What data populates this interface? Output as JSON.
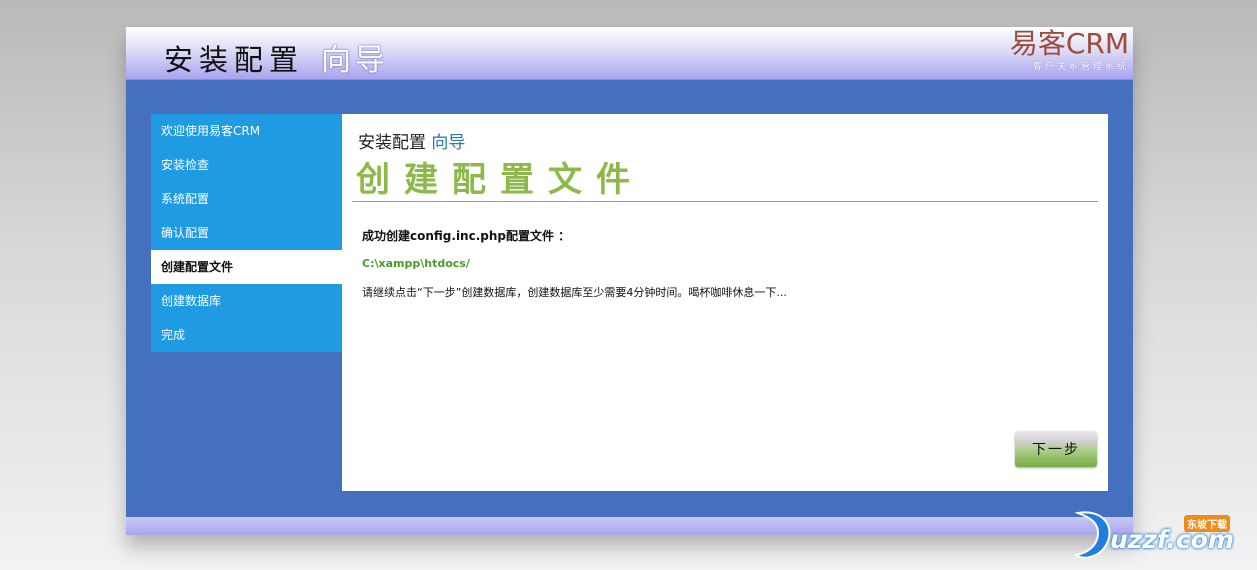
{
  "header": {
    "title_main": "安装配置",
    "title_accent": "向导",
    "brand_name": "易客CRM",
    "brand_sub": "客户关系管理系统"
  },
  "sidebar": {
    "items": [
      {
        "label": "欢迎使用易客CRM",
        "active": false
      },
      {
        "label": "安装检查",
        "active": false
      },
      {
        "label": "系统配置",
        "active": false
      },
      {
        "label": "确认配置",
        "active": false
      },
      {
        "label": "创建配置文件",
        "active": true
      },
      {
        "label": "创建数据库",
        "active": false
      },
      {
        "label": "完成",
        "active": false
      }
    ]
  },
  "main": {
    "title_small": "安装配置",
    "title_small_accent": "向导",
    "title_big": "创建配置文件",
    "success_message": "成功创建config.inc.php配置文件 ：",
    "path": "C:\\xampp\\htdocs/",
    "hint": "请继续点击“下一步”创建数据库，创建数据库至少需要4分钟时间。喝杯咖啡休息一下...",
    "next_button": "下一步"
  },
  "watermark": {
    "text": "uzzf.com",
    "tag": "东坡下载"
  },
  "colors": {
    "frame_blue": "#4470bf",
    "sidebar_blue": "#1e9be3",
    "title_green": "#8db94a",
    "accent_blue": "#2f73b7",
    "brand_red": "#9f4a3a"
  }
}
